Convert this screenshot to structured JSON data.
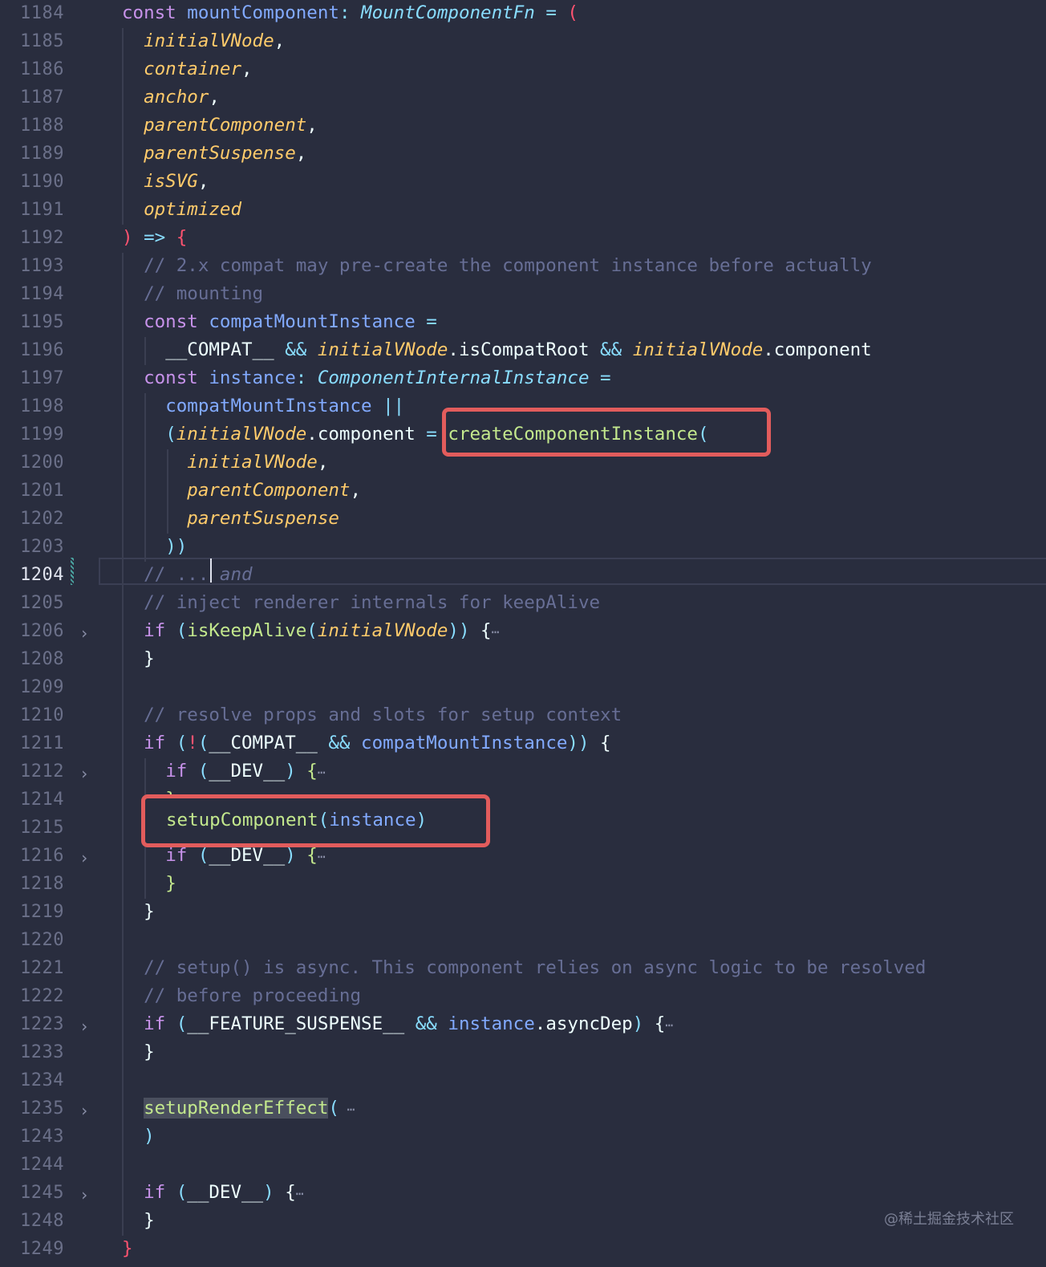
{
  "editor": {
    "lines": [
      {
        "num": "1184",
        "fold": false,
        "html_tokens": [
          [
            "k",
            "const "
          ],
          [
            "f",
            "mountComponent"
          ],
          [
            "o",
            ": "
          ],
          [
            "ty",
            "MountComponentFn"
          ],
          [
            "o",
            " = "
          ],
          [
            "pr",
            "("
          ]
        ]
      },
      {
        "num": "1185",
        "fold": false,
        "html_tokens": [
          [
            "v",
            "  "
          ],
          [
            "t",
            "initialVNode"
          ],
          [
            "w",
            ","
          ]
        ]
      },
      {
        "num": "1186",
        "fold": false,
        "html_tokens": [
          [
            "v",
            "  "
          ],
          [
            "t",
            "container"
          ],
          [
            "w",
            ","
          ]
        ]
      },
      {
        "num": "1187",
        "fold": false,
        "html_tokens": [
          [
            "v",
            "  "
          ],
          [
            "t",
            "anchor"
          ],
          [
            "w",
            ","
          ]
        ]
      },
      {
        "num": "1188",
        "fold": false,
        "html_tokens": [
          [
            "v",
            "  "
          ],
          [
            "t",
            "parentComponent"
          ],
          [
            "w",
            ","
          ]
        ]
      },
      {
        "num": "1189",
        "fold": false,
        "html_tokens": [
          [
            "v",
            "  "
          ],
          [
            "t",
            "parentSuspense"
          ],
          [
            "w",
            ","
          ]
        ]
      },
      {
        "num": "1190",
        "fold": false,
        "html_tokens": [
          [
            "v",
            "  "
          ],
          [
            "t",
            "isSVG"
          ],
          [
            "w",
            ","
          ]
        ]
      },
      {
        "num": "1191",
        "fold": false,
        "html_tokens": [
          [
            "v",
            "  "
          ],
          [
            "t",
            "optimized"
          ]
        ]
      },
      {
        "num": "1192",
        "fold": false,
        "html_tokens": [
          [
            "pr",
            ")"
          ],
          [
            "o",
            " => "
          ],
          [
            "pr",
            "{"
          ]
        ]
      },
      {
        "num": "1193",
        "fold": false,
        "html_tokens": [
          [
            "c",
            "  // 2.x compat may pre-create the component instance before actually"
          ]
        ]
      },
      {
        "num": "1194",
        "fold": false,
        "html_tokens": [
          [
            "c",
            "  // mounting"
          ]
        ]
      },
      {
        "num": "1195",
        "fold": false,
        "html_tokens": [
          [
            "v",
            "  "
          ],
          [
            "k",
            "const "
          ],
          [
            "f",
            "compatMountInstance"
          ],
          [
            "o",
            " ="
          ]
        ]
      },
      {
        "num": "1196",
        "fold": false,
        "html_tokens": [
          [
            "v",
            "    "
          ],
          [
            "w",
            "__COMPAT__"
          ],
          [
            "o",
            " && "
          ],
          [
            "t",
            "initialVNode"
          ],
          [
            "w",
            ".isCompatRoot"
          ],
          [
            "o",
            " && "
          ],
          [
            "t",
            "initialVNode"
          ],
          [
            "w",
            ".component"
          ]
        ]
      },
      {
        "num": "1197",
        "fold": false,
        "html_tokens": [
          [
            "v",
            "  "
          ],
          [
            "k",
            "const "
          ],
          [
            "f",
            "instance"
          ],
          [
            "o",
            ": "
          ],
          [
            "ty",
            "ComponentInternalInstance"
          ],
          [
            "o",
            " ="
          ]
        ]
      },
      {
        "num": "1198",
        "fold": false,
        "html_tokens": [
          [
            "v",
            "    "
          ],
          [
            "f",
            "compatMountInstance"
          ],
          [
            "o",
            " ||"
          ]
        ]
      },
      {
        "num": "1199",
        "fold": false,
        "html_tokens": [
          [
            "v",
            "    "
          ],
          [
            "o",
            "("
          ],
          [
            "t",
            "initialVNode"
          ],
          [
            "w",
            ".component"
          ],
          [
            "o",
            " = "
          ],
          [
            "g",
            "createComponentInstance"
          ],
          [
            "o",
            "("
          ]
        ]
      },
      {
        "num": "1200",
        "fold": false,
        "html_tokens": [
          [
            "v",
            "      "
          ],
          [
            "t",
            "initialVNode"
          ],
          [
            "w",
            ","
          ]
        ]
      },
      {
        "num": "1201",
        "fold": false,
        "html_tokens": [
          [
            "v",
            "      "
          ],
          [
            "t",
            "parentComponent"
          ],
          [
            "w",
            ","
          ]
        ]
      },
      {
        "num": "1202",
        "fold": false,
        "html_tokens": [
          [
            "v",
            "      "
          ],
          [
            "t",
            "parentSuspense"
          ]
        ]
      },
      {
        "num": "1203",
        "fold": false,
        "html_tokens": [
          [
            "v",
            "    "
          ],
          [
            "o",
            "))"
          ]
        ]
      },
      {
        "num": "1204",
        "fold": false,
        "active": true,
        "html_tokens": [
          [
            "c",
            "  // ..."
          ],
          [
            "ci",
            " and"
          ]
        ]
      },
      {
        "num": "1205",
        "fold": false,
        "html_tokens": [
          [
            "c",
            "  // inject renderer internals for keepAlive"
          ]
        ]
      },
      {
        "num": "1206",
        "fold": true,
        "html_tokens": [
          [
            "v",
            "  "
          ],
          [
            "k",
            "if "
          ],
          [
            "o",
            "("
          ],
          [
            "g",
            "isKeepAlive"
          ],
          [
            "o",
            "("
          ],
          [
            "t",
            "initialVNode"
          ],
          [
            "o",
            "))"
          ],
          [
            "w",
            " {"
          ],
          [
            "ell",
            "⋯"
          ]
        ]
      },
      {
        "num": "1208",
        "fold": false,
        "html_tokens": [
          [
            "v",
            "  "
          ],
          [
            "w",
            "}"
          ]
        ]
      },
      {
        "num": "1209",
        "fold": false,
        "html_tokens": [
          [
            "v",
            ""
          ]
        ]
      },
      {
        "num": "1210",
        "fold": false,
        "html_tokens": [
          [
            "c",
            "  // resolve props and slots for setup context"
          ]
        ]
      },
      {
        "num": "1211",
        "fold": false,
        "html_tokens": [
          [
            "v",
            "  "
          ],
          [
            "k",
            "if "
          ],
          [
            "o",
            "("
          ],
          [
            "pr",
            "!"
          ],
          [
            "o",
            "("
          ],
          [
            "w",
            "__COMPAT__"
          ],
          [
            "o",
            " && "
          ],
          [
            "f",
            "compatMountInstance"
          ],
          [
            "o",
            "))"
          ],
          [
            "w",
            " {"
          ]
        ]
      },
      {
        "num": "1212",
        "fold": true,
        "html_tokens": [
          [
            "v",
            "    "
          ],
          [
            "k",
            "if "
          ],
          [
            "o",
            "("
          ],
          [
            "w",
            "__DEV__"
          ],
          [
            "o",
            ")"
          ],
          [
            "g",
            " {"
          ],
          [
            "ell",
            "⋯"
          ]
        ]
      },
      {
        "num": "1214",
        "fold": false,
        "html_tokens": [
          [
            "v",
            "    "
          ],
          [
            "g",
            "}"
          ]
        ]
      },
      {
        "num": "1215",
        "fold": false,
        "html_tokens": [
          [
            "v",
            ""
          ]
        ]
      },
      {
        "num": "1216",
        "fold": true,
        "html_tokens": [
          [
            "v",
            "    "
          ],
          [
            "k",
            "if "
          ],
          [
            "o",
            "("
          ],
          [
            "w",
            "__DEV__"
          ],
          [
            "o",
            ")"
          ],
          [
            "g",
            " {"
          ],
          [
            "ell",
            "⋯"
          ]
        ]
      },
      {
        "num": "1218",
        "fold": false,
        "html_tokens": [
          [
            "v",
            "    "
          ],
          [
            "g",
            "}"
          ]
        ]
      },
      {
        "num": "1219",
        "fold": false,
        "html_tokens": [
          [
            "v",
            "  "
          ],
          [
            "w",
            "}"
          ]
        ]
      },
      {
        "num": "1220",
        "fold": false,
        "html_tokens": [
          [
            "v",
            ""
          ]
        ]
      },
      {
        "num": "1221",
        "fold": false,
        "html_tokens": [
          [
            "c",
            "  // setup() is async. This component relies on async logic to be resolved"
          ]
        ]
      },
      {
        "num": "1222",
        "fold": false,
        "html_tokens": [
          [
            "c",
            "  // before proceeding"
          ]
        ]
      },
      {
        "num": "1223",
        "fold": true,
        "html_tokens": [
          [
            "v",
            "  "
          ],
          [
            "k",
            "if "
          ],
          [
            "o",
            "("
          ],
          [
            "w",
            "__FEATURE_SUSPENSE__"
          ],
          [
            "o",
            " && "
          ],
          [
            "f",
            "instance"
          ],
          [
            "w",
            ".asyncDep"
          ],
          [
            "o",
            ")"
          ],
          [
            "w",
            " {"
          ],
          [
            "ell",
            "⋯"
          ]
        ]
      },
      {
        "num": "1233",
        "fold": false,
        "html_tokens": [
          [
            "v",
            "  "
          ],
          [
            "w",
            "}"
          ]
        ]
      },
      {
        "num": "1234",
        "fold": false,
        "html_tokens": [
          [
            "v",
            ""
          ]
        ]
      },
      {
        "num": "1235",
        "fold": true,
        "html_tokens": [
          [
            "v",
            "  "
          ],
          [
            "g hl-word",
            "setupRenderEffect"
          ],
          [
            "o",
            "("
          ],
          [
            "ell",
            " ⋯"
          ]
        ]
      },
      {
        "num": "1243",
        "fold": false,
        "html_tokens": [
          [
            "v",
            "  "
          ],
          [
            "o",
            ")"
          ]
        ]
      },
      {
        "num": "1244",
        "fold": false,
        "html_tokens": [
          [
            "v",
            ""
          ]
        ]
      },
      {
        "num": "1245",
        "fold": true,
        "html_tokens": [
          [
            "v",
            "  "
          ],
          [
            "k",
            "if "
          ],
          [
            "o",
            "("
          ],
          [
            "w",
            "__DEV__"
          ],
          [
            "o",
            ")"
          ],
          [
            "w",
            " {"
          ],
          [
            "ell",
            "⋯"
          ]
        ]
      },
      {
        "num": "1248",
        "fold": false,
        "html_tokens": [
          [
            "v",
            "  "
          ],
          [
            "w",
            "}"
          ]
        ]
      },
      {
        "num": "1249",
        "fold": false,
        "html_tokens": [
          [
            "pr",
            "}"
          ]
        ]
      }
    ],
    "highlighted_call_1": "createComponentInstance(",
    "highlighted_call_2_fn": "setupComponent",
    "highlighted_call_2_arg": "instance",
    "watermark": "@稀土掘金技术社区"
  }
}
